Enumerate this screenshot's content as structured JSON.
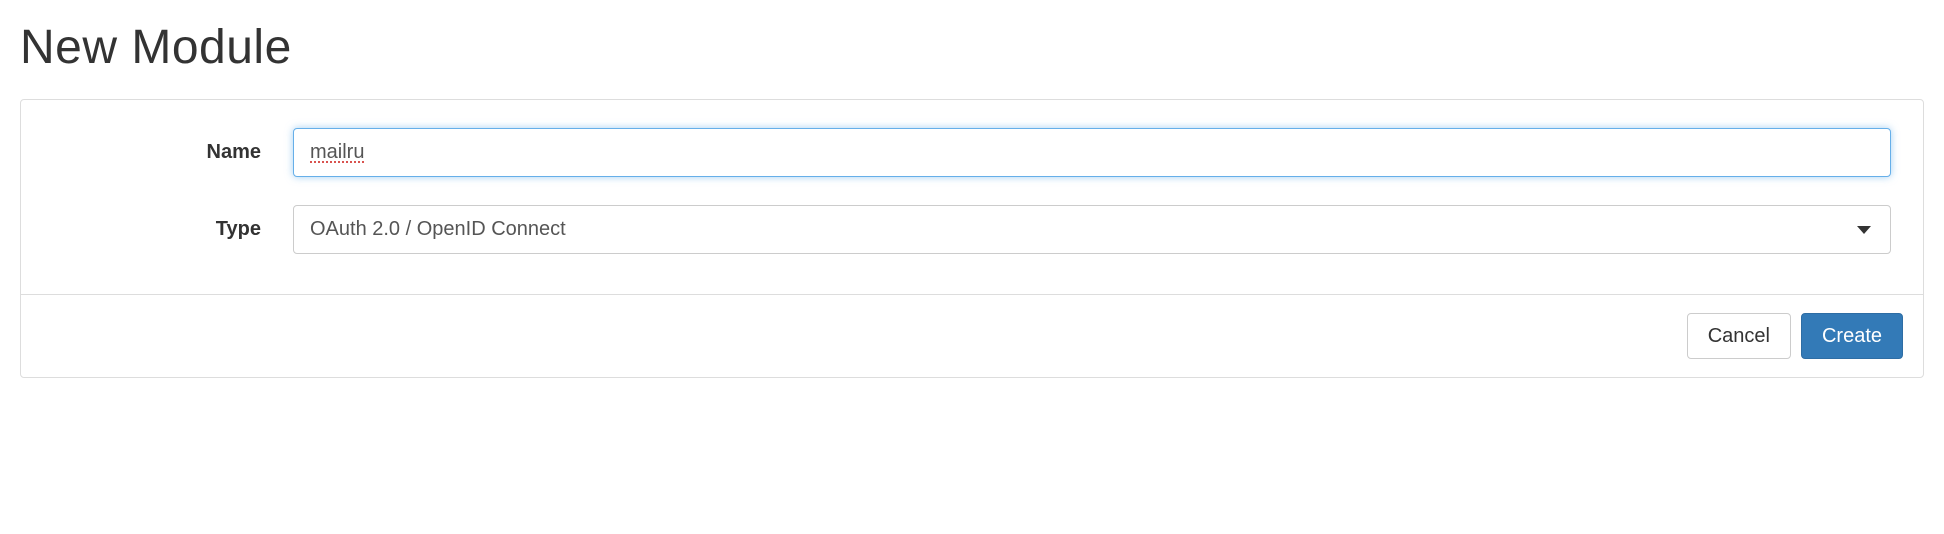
{
  "page": {
    "title": "New Module"
  },
  "form": {
    "name": {
      "label": "Name",
      "value": "mailru"
    },
    "type": {
      "label": "Type",
      "value": "OAuth 2.0 / OpenID Connect"
    }
  },
  "footer": {
    "cancel_label": "Cancel",
    "create_label": "Create"
  }
}
